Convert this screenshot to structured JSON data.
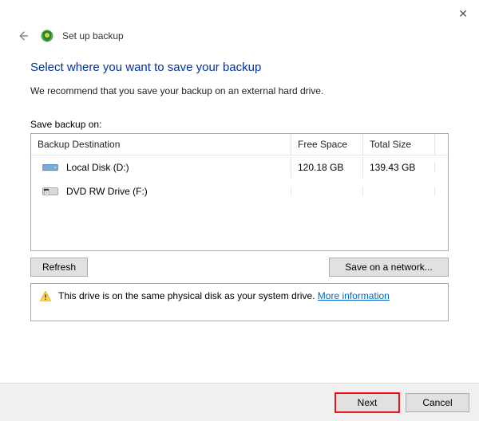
{
  "window": {
    "title": "Set up backup"
  },
  "page": {
    "heading": "Select where you want to save your backup",
    "recommendation": "We recommend that you save your backup on an external hard drive.",
    "list_label": "Save backup on:"
  },
  "table": {
    "headers": {
      "destination": "Backup Destination",
      "free": "Free Space",
      "total": "Total Size"
    },
    "rows": [
      {
        "name": "Local Disk (D:)",
        "free": "120.18 GB",
        "total": "139.43 GB",
        "icon": "hdd"
      },
      {
        "name": "DVD RW Drive (F:)",
        "free": "",
        "total": "",
        "icon": "dvd"
      }
    ]
  },
  "buttons": {
    "refresh": "Refresh",
    "network": "Save on a network...",
    "next": "Next",
    "cancel": "Cancel"
  },
  "warning": {
    "text": "This drive is on the same physical disk as your system drive.",
    "link": "More information"
  }
}
